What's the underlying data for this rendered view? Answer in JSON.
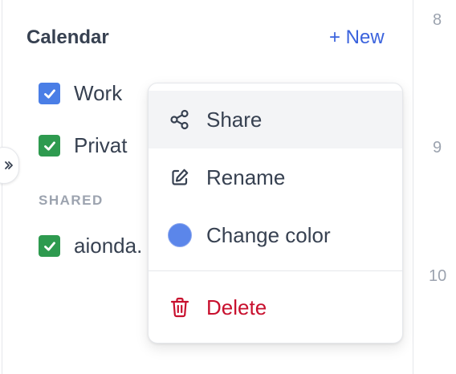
{
  "sidebar": {
    "title": "Calendar",
    "new_button": "+ New",
    "calendars": [
      {
        "label": "Work",
        "checked": true,
        "color": "#4a7ee6"
      },
      {
        "label": "Privat",
        "checked": true,
        "color": "#2e9a4f"
      }
    ],
    "shared_section_label": "SHARED",
    "shared_calendars": [
      {
        "label": "aionda.",
        "checked": true,
        "color": "#2e9a4f"
      }
    ],
    "expand_icon": "chevron-right-double-icon"
  },
  "time_axis": {
    "labels": [
      "8",
      "9",
      "10"
    ]
  },
  "context_menu": {
    "items": [
      {
        "label": "Share",
        "icon": "share-icon",
        "highlighted": true
      },
      {
        "label": "Rename",
        "icon": "edit-icon"
      },
      {
        "label": "Change color",
        "icon": "color-dot",
        "color": "#5b86ea"
      },
      {
        "label": "Delete",
        "icon": "trash-icon",
        "color": "#c8102e"
      }
    ]
  },
  "colors": {
    "accent": "#3b63dd",
    "danger": "#c8102e",
    "border": "#e5e7eb"
  }
}
